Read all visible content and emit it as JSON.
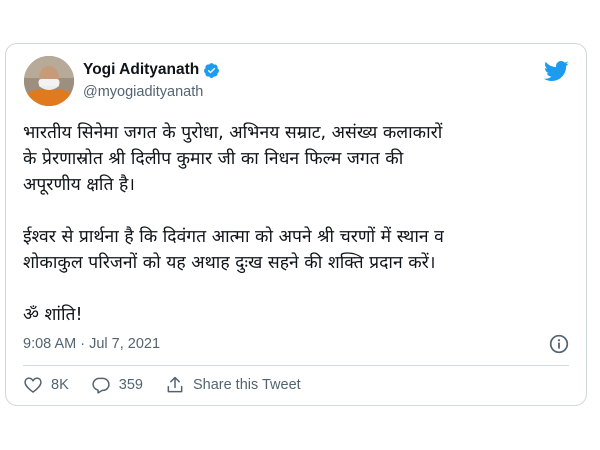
{
  "tweet": {
    "author": {
      "name": "Yogi Adityanath",
      "handle": "@myogiadityanath",
      "verified": true
    },
    "paragraphs": [
      "भारतीय सिनेमा जगत के पुरोधा, अभिनय सम्राट, असंख्य कलाकारों\nके प्रेरणास्रोत श्री दिलीप कुमार जी का निधन फिल्म जगत की\nअपूरणीय क्षति है।",
      "ईश्वर से प्रार्थना है कि दिवंगत आत्मा को अपने श्री चरणों में स्थान व\nशोकाकुल परिजनों को यह अथाह दुःख सहने की शक्ति प्रदान करें।",
      "ॐ शांति!"
    ],
    "timestamp": "9:08 AM · Jul 7, 2021",
    "likes": "8K",
    "replies": "359",
    "share_label": "Share this Tweet"
  },
  "colors": {
    "brand_blue": "#1d9bf0",
    "text_primary": "#0f1419",
    "text_secondary": "#536471",
    "border": "#cfd9de"
  },
  "icons": [
    "verified-badge-icon",
    "twitter-bird-icon",
    "info-icon",
    "heart-icon",
    "reply-icon",
    "share-icon"
  ]
}
